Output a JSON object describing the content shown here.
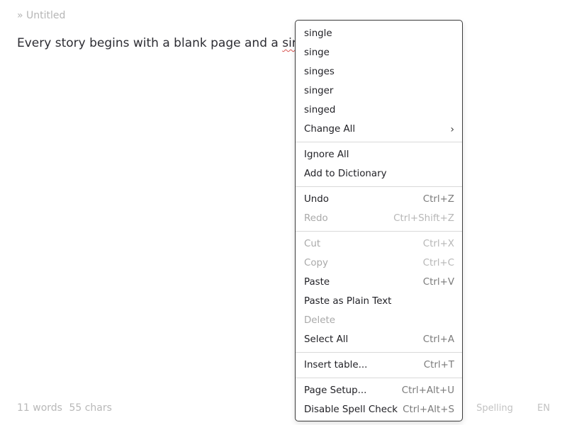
{
  "document": {
    "title": "» Untitled",
    "text_before": "Every story begins with a blank page and a ",
    "misspelled_word": "singel"
  },
  "status": {
    "words": "11 words",
    "chars": "55 chars",
    "spelling": "Spelling",
    "language": "EN"
  },
  "context_menu": {
    "suggestions": [
      "single",
      "singe",
      "singes",
      "singer",
      "singed"
    ],
    "change_all": "Change All",
    "ignore_all": "Ignore All",
    "add_to_dictionary": "Add to Dictionary",
    "undo": {
      "label": "Undo",
      "shortcut": "Ctrl+Z"
    },
    "redo": {
      "label": "Redo",
      "shortcut": "Ctrl+Shift+Z"
    },
    "cut": {
      "label": "Cut",
      "shortcut": "Ctrl+X"
    },
    "copy": {
      "label": "Copy",
      "shortcut": "Ctrl+C"
    },
    "paste": {
      "label": "Paste",
      "shortcut": "Ctrl+V"
    },
    "paste_plain": {
      "label": "Paste as Plain Text"
    },
    "delete": {
      "label": "Delete"
    },
    "select_all": {
      "label": "Select All",
      "shortcut": "Ctrl+A"
    },
    "insert_table": {
      "label": "Insert table...",
      "shortcut": "Ctrl+T"
    },
    "page_setup": {
      "label": "Page Setup...",
      "shortcut": "Ctrl+Alt+U"
    },
    "disable_spell": {
      "label": "Disable Spell Check",
      "shortcut": "Ctrl+Alt+S"
    }
  },
  "icons": {
    "submenu_arrow": "chevron-right-icon"
  }
}
